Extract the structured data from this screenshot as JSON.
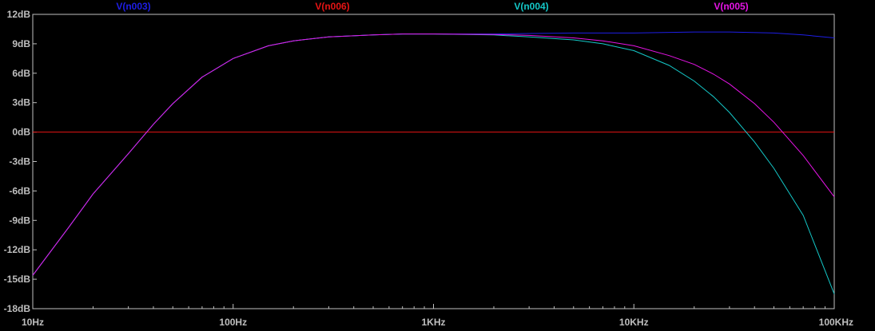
{
  "chart_data": {
    "type": "line",
    "title": "",
    "xlabel": "",
    "ylabel": "",
    "x_scale": "log",
    "xlim": [
      10,
      100000
    ],
    "ylim": [
      -18,
      12
    ],
    "grid": false,
    "legend_position": "top",
    "background": "#000000",
    "axis_color": "#bfbfbf",
    "x_ticks": [
      {
        "value": 10,
        "label": "10Hz"
      },
      {
        "value": 100,
        "label": "100Hz"
      },
      {
        "value": 1000,
        "label": "1KHz"
      },
      {
        "value": 10000,
        "label": "10KHz"
      },
      {
        "value": 100000,
        "label": "100KHz"
      }
    ],
    "y_ticks": [
      {
        "value": 12,
        "label": "12dB"
      },
      {
        "value": 9,
        "label": "9dB"
      },
      {
        "value": 6,
        "label": "6dB"
      },
      {
        "value": 3,
        "label": "3dB"
      },
      {
        "value": 0,
        "label": "0dB"
      },
      {
        "value": -3,
        "label": "-3dB"
      },
      {
        "value": -6,
        "label": "-6dB"
      },
      {
        "value": -9,
        "label": "-9dB"
      },
      {
        "value": -12,
        "label": "-12dB"
      },
      {
        "value": -15,
        "label": "-15dB"
      },
      {
        "value": -18,
        "label": "-18dB"
      }
    ],
    "series": [
      {
        "name": "V(n003)",
        "color": "#1e1ee6",
        "x": [
          10,
          15,
          20,
          30,
          40,
          50,
          70,
          100,
          150,
          200,
          300,
          500,
          700,
          1000,
          2000,
          3000,
          5000,
          10000,
          20000,
          30000,
          50000,
          70000,
          100000
        ],
        "y": [
          -14.6,
          -9.8,
          -6.3,
          -2.2,
          0.8,
          2.9,
          5.6,
          7.5,
          8.8,
          9.3,
          9.7,
          9.9,
          10.0,
          10.0,
          10.0,
          10.05,
          10.1,
          10.1,
          10.2,
          10.2,
          10.1,
          9.9,
          9.6
        ]
      },
      {
        "name": "V(n006)",
        "color": "#e61414",
        "x": [
          10,
          100000
        ],
        "y": [
          0,
          0
        ]
      },
      {
        "name": "V(n004)",
        "color": "#14c8c8",
        "x": [
          10,
          15,
          20,
          30,
          40,
          50,
          70,
          100,
          150,
          200,
          300,
          500,
          700,
          1000,
          2000,
          3000,
          5000,
          7000,
          10000,
          15000,
          20000,
          25000,
          30000,
          40000,
          50000,
          70000,
          100000
        ],
        "y": [
          -14.6,
          -9.8,
          -6.3,
          -2.2,
          0.8,
          2.9,
          5.6,
          7.5,
          8.8,
          9.3,
          9.7,
          9.9,
          10.0,
          10.0,
          9.9,
          9.7,
          9.4,
          9.0,
          8.3,
          6.8,
          5.2,
          3.6,
          2.0,
          -1.0,
          -3.7,
          -8.5,
          -16.5
        ]
      },
      {
        "name": "V(n005)",
        "color": "#e614e6",
        "x": [
          10,
          15,
          20,
          30,
          40,
          50,
          70,
          100,
          150,
          200,
          300,
          500,
          700,
          1000,
          2000,
          3000,
          5000,
          7000,
          10000,
          15000,
          20000,
          25000,
          30000,
          40000,
          50000,
          70000,
          100000
        ],
        "y": [
          -14.6,
          -9.8,
          -6.3,
          -2.2,
          0.8,
          2.9,
          5.6,
          7.5,
          8.8,
          9.3,
          9.7,
          9.9,
          10.0,
          10.0,
          9.95,
          9.85,
          9.6,
          9.3,
          8.8,
          7.8,
          6.9,
          5.9,
          4.9,
          2.9,
          1.0,
          -2.4,
          -6.6
        ]
      }
    ]
  }
}
